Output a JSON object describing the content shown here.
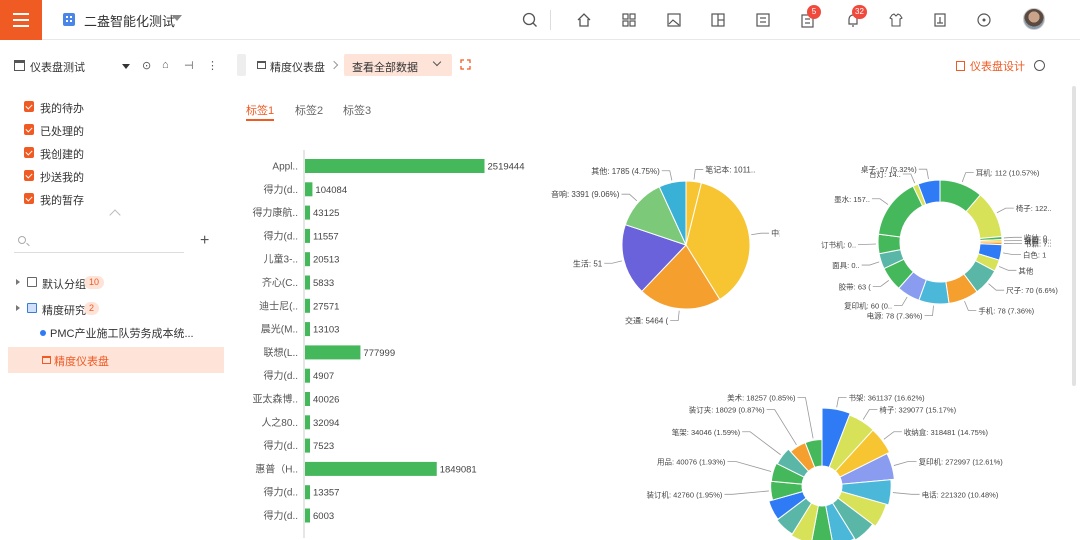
{
  "app": {
    "title": "二盎智能化测试"
  },
  "badges": {
    "approvals": "5",
    "notifications": "32"
  },
  "sidebar": {
    "dashboard_title": "仪表盘测试",
    "todos": [
      {
        "label": "我的待办"
      },
      {
        "label": "已处理的"
      },
      {
        "label": "我创建的"
      },
      {
        "label": "抄送我的"
      },
      {
        "label": "我的暂存"
      }
    ],
    "groups": [
      {
        "label": "默认分组",
        "count": "10"
      },
      {
        "label": "精度研究",
        "count": "2"
      }
    ],
    "sub_item": "PMC产业施工队劳务成本统...",
    "selected_item": "精度仪表盘"
  },
  "header": {
    "breadcrumb": "精度仪表盘",
    "view_select": "查看全部数据",
    "design_button": "仪表盘设计"
  },
  "tabs": [
    {
      "label": "标签1"
    },
    {
      "label": "标签2"
    },
    {
      "label": "标签3"
    }
  ],
  "colors": {
    "accent": "#f05a23",
    "bar": "#45b85c"
  },
  "chart_data": [
    {
      "type": "bar",
      "orientation": "horizontal",
      "categories": [
        "Appl..",
        "得力(d..",
        "得力康航..",
        "得力(d..",
        "儿童3-..",
        "齐心(C..",
        "迪士尼(..",
        "晨光(M..",
        "联想(L..",
        "得力(d..",
        "亚太森博..",
        "人之80..",
        "得力(d..",
        "惠普（H..",
        "得力(d..",
        "得力(d.."
      ],
      "values": [
        2519444,
        104084,
        43125,
        11557,
        20513,
        5833,
        27571,
        13103,
        777999,
        4907,
        40026,
        32094,
        7523,
        1849081,
        13357,
        6003
      ],
      "labels": [
        "2519444",
        "104084",
        "43125",
        "11557",
        "20513",
        "5833",
        "27571",
        "13103",
        "777999",
        "4907",
        "40026",
        "32094",
        "7523",
        "1849081",
        "13357",
        "6003"
      ],
      "xlim": [
        0,
        2800000
      ]
    },
    {
      "type": "pie",
      "slices": [
        {
          "label": "笔记本: 1011..",
          "value": 1011,
          "color": "#f7c531"
        },
        {
          "label": "中高: 9720 (25.84%)",
          "value": 9720,
          "color": "#f7c531"
        },
        {
          "label": "交通: 5464 (",
          "value": 5464,
          "color": "#f59f2f"
        },
        {
          "label": "生活: 51",
          "value": 4700,
          "color": "#6a62db"
        },
        {
          "label": "音响: 3391 (9.06%)",
          "value": 3391,
          "color": "#7cc97a"
        },
        {
          "label": "其他: 1785 (4.75%)",
          "value": 1785,
          "color": "#39b0d6"
        }
      ]
    },
    {
      "type": "donut",
      "slices": [
        {
          "label": "耳机: 112 (10.57%)",
          "value": 112,
          "color": "#45b85c"
        },
        {
          "label": "椅子: 122..",
          "value": 122,
          "color": "#d7e258"
        },
        {
          "label": "收纳: 0..",
          "value": 8,
          "color": "#45b85c"
        },
        {
          "label": "键盘: 0..",
          "value": 6,
          "color": "#f7c531"
        },
        {
          "label": "书籍: 7..",
          "value": 7,
          "color": "#f59f2f"
        },
        {
          "label": "白色: 1",
          "value": 40,
          "color": "#2f7bf6"
        },
        {
          "label": "其他",
          "value": 30,
          "color": "#d7e258"
        },
        {
          "label": "尺子: 70 (6.6%)",
          "value": 70,
          "color": "#5ab7a8"
        },
        {
          "label": "手机: 78 (7.36%)",
          "value": 78,
          "color": "#f59f2f"
        },
        {
          "label": "电源: 78 (7.36%)",
          "value": 78,
          "color": "#4bb8d9"
        },
        {
          "label": "复印机: 60 (0..",
          "value": 60,
          "color": "#8a9cf0"
        },
        {
          "label": "胶带: 63 (",
          "value": 63,
          "color": "#45b85c"
        },
        {
          "label": "面具: 0..",
          "value": 40,
          "color": "#5ab7a8"
        },
        {
          "label": "订书机: 0..",
          "value": 50,
          "color": "#45b85c"
        },
        {
          "label": "墨水: 157..",
          "value": 157,
          "color": "#45b85c"
        },
        {
          "label": "台灯: 14..",
          "value": 14,
          "color": "#d7e258"
        },
        {
          "label": "桌子: 57 (5.32%)",
          "value": 57,
          "color": "#2f7bf6"
        }
      ]
    },
    {
      "type": "rose",
      "slices": [
        {
          "label": "书架: 361137 (16.62%)",
          "value": 361137,
          "color": "#2f7bf6"
        },
        {
          "label": "椅子: 329077 (15.17%)",
          "value": 329077,
          "color": "#d7e258"
        },
        {
          "label": "收纳盒: 318481 (14.75%)",
          "value": 318481,
          "color": "#f7c531"
        },
        {
          "label": "复印机: 272997 (12.61%)",
          "value": 272997,
          "color": "#8a9cf0"
        },
        {
          "label": "电话: 221320 (10.48%)",
          "value": 221320,
          "color": "#4bb8d9"
        },
        {
          "label": "",
          "value": 190000,
          "color": "#d7e258"
        },
        {
          "label": "",
          "value": 150000,
          "color": "#5ab7a8"
        },
        {
          "label": "",
          "value": 130000,
          "color": "#4bb8d9"
        },
        {
          "label": "",
          "value": 110000,
          "color": "#45b85c"
        },
        {
          "label": "",
          "value": 95000,
          "color": "#d7e258"
        },
        {
          "label": "",
          "value": 80000,
          "color": "#5ab7a8"
        },
        {
          "label": "",
          "value": 70000,
          "color": "#2f7bf6"
        },
        {
          "label": "装订机: 42760 (1.95%)",
          "value": 42760,
          "color": "#45b85c"
        },
        {
          "label": "用品: 40076 (1.93%)",
          "value": 40076,
          "color": "#45b85c"
        },
        {
          "label": "笔架: 34046 (1.59%)",
          "value": 34046,
          "color": "#5ab7a8"
        },
        {
          "label": "装订夹: 18029 (0.87%)",
          "value": 18029,
          "color": "#f59f2f"
        },
        {
          "label": "美术: 18257 (0.85%)",
          "value": 18257,
          "color": "#45b85c"
        }
      ]
    }
  ]
}
